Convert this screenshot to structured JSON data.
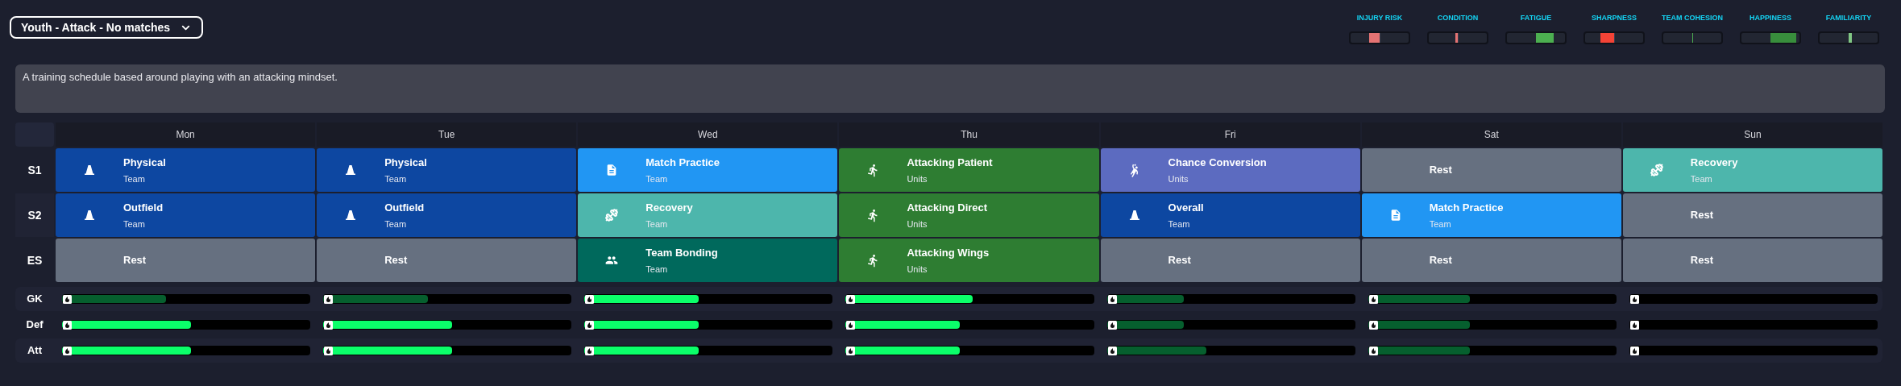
{
  "schedule_select": {
    "value": "Youth - Attack - No matches"
  },
  "meters": [
    {
      "label": "INJURY RISK",
      "color": "#e57373"
    },
    {
      "label": "CONDITION",
      "color": "#e57373"
    },
    {
      "label": "FATIGUE",
      "color": "#4caf50"
    },
    {
      "label": "SHARPNESS",
      "color": "#f44336"
    },
    {
      "label": "TEAM COHESION",
      "color": "#4caf50"
    },
    {
      "label": "HAPPINESS",
      "color": "#388e3c"
    },
    {
      "label": "FAMILIARITY",
      "color": "#81c784"
    }
  ],
  "description": "A training schedule based around playing with an attacking mindset.",
  "days": [
    "Mon",
    "Tue",
    "Wed",
    "Thu",
    "Fri",
    "Sat",
    "Sun"
  ],
  "sessions": [
    {
      "label": "S1",
      "cells": [
        {
          "title": "Physical",
          "group": "Team",
          "kind": "cone",
          "color": "#0d47a1"
        },
        {
          "title": "Physical",
          "group": "Team",
          "kind": "cone",
          "color": "#0d47a1"
        },
        {
          "title": "Match Practice",
          "group": "Team",
          "kind": "document",
          "color": "#2196f3"
        },
        {
          "title": "Attacking Patient",
          "group": "Units",
          "kind": "runner",
          "color": "#2e7d32"
        },
        {
          "title": "Chance Conversion",
          "group": "Units",
          "kind": "kicker",
          "color": "#5c6bc0"
        },
        {
          "title": "Rest",
          "kind": "rest",
          "color": "#667080"
        },
        {
          "title": "Recovery",
          "group": "Team",
          "kind": "dumbbell",
          "color": "#4db6ac"
        }
      ]
    },
    {
      "label": "S2",
      "cells": [
        {
          "title": "Outfield",
          "group": "Team",
          "kind": "cone",
          "color": "#0d47a1"
        },
        {
          "title": "Outfield",
          "group": "Team",
          "kind": "cone",
          "color": "#0d47a1"
        },
        {
          "title": "Recovery",
          "group": "Team",
          "kind": "dumbbell",
          "color": "#4db6ac"
        },
        {
          "title": "Attacking Direct",
          "group": "Units",
          "kind": "runner",
          "color": "#2e7d32"
        },
        {
          "title": "Overall",
          "group": "Team",
          "kind": "cone",
          "color": "#0d47a1"
        },
        {
          "title": "Match Practice",
          "group": "Team",
          "kind": "document",
          "color": "#2196f3"
        },
        {
          "title": "Rest",
          "kind": "rest",
          "color": "#667080"
        }
      ]
    },
    {
      "label": "ES",
      "cells": [
        {
          "title": "Rest",
          "kind": "rest",
          "color": "#667080"
        },
        {
          "title": "Rest",
          "kind": "rest",
          "color": "#667080"
        },
        {
          "title": "Team Bonding",
          "group": "Team",
          "kind": "people",
          "color": "#00695c"
        },
        {
          "title": "Attacking Wings",
          "group": "Units",
          "kind": "runner",
          "color": "#2e7d32"
        },
        {
          "title": "Rest",
          "kind": "rest",
          "color": "#667080"
        },
        {
          "title": "Rest",
          "kind": "rest",
          "color": "#667080"
        },
        {
          "title": "Rest",
          "kind": "rest",
          "color": "#667080"
        }
      ]
    }
  ],
  "workload": [
    {
      "label": "GK",
      "bars": [
        {
          "kind": "filled",
          "level": 0.42,
          "color": "#065f2e"
        },
        {
          "kind": "filled",
          "level": 0.42,
          "color": "#065f2e"
        },
        {
          "kind": "filled",
          "level": 0.46,
          "color": "#0bff6a"
        },
        {
          "kind": "filled",
          "level": 0.51,
          "color": "#0bff6a"
        },
        {
          "kind": "filled",
          "level": 0.31,
          "color": "#065f2e"
        },
        {
          "kind": "filled",
          "level": 0.41,
          "color": "#065f2e"
        },
        {
          "kind": "empty"
        }
      ]
    },
    {
      "label": "Def",
      "bars": [
        {
          "kind": "filled",
          "level": 0.52,
          "color": "#0bff6a"
        },
        {
          "kind": "filled",
          "level": 0.52,
          "color": "#0bff6a"
        },
        {
          "kind": "filled",
          "level": 0.46,
          "color": "#0bff6a"
        },
        {
          "kind": "filled",
          "level": 0.46,
          "color": "#0bff6a"
        },
        {
          "kind": "filled",
          "level": 0.31,
          "color": "#065f2e"
        },
        {
          "kind": "filled",
          "level": 0.41,
          "color": "#065f2e"
        },
        {
          "kind": "empty"
        }
      ]
    },
    {
      "label": "Att",
      "bars": [
        {
          "kind": "filled",
          "level": 0.52,
          "color": "#0bff6a"
        },
        {
          "kind": "filled",
          "level": 0.52,
          "color": "#0bff6a"
        },
        {
          "kind": "filled",
          "level": 0.46,
          "color": "#0bff6a"
        },
        {
          "kind": "filled",
          "level": 0.46,
          "color": "#0bff6a"
        },
        {
          "kind": "filled",
          "level": 0.4,
          "color": "#065f2e"
        },
        {
          "kind": "filled",
          "level": 0.41,
          "color": "#065f2e"
        },
        {
          "kind": "empty"
        }
      ]
    }
  ]
}
